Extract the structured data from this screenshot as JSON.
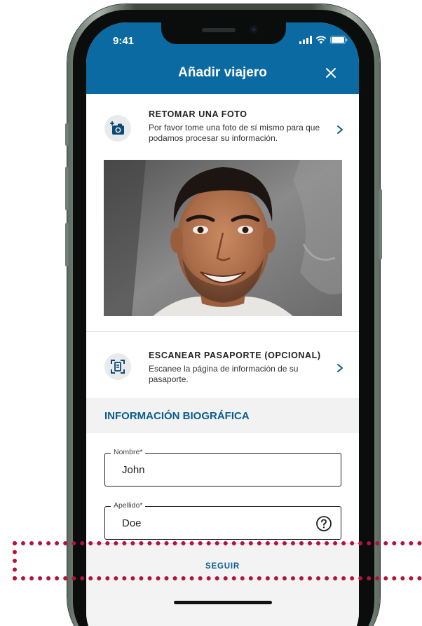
{
  "status_bar": {
    "time": "9:41",
    "icons": [
      "signal-icon",
      "wifi-icon",
      "battery-icon"
    ]
  },
  "header": {
    "title": "Añadir viajero",
    "close_icon": "close-icon"
  },
  "photo_row": {
    "title": "RETOMAR UNA FOTO",
    "description": "Por favor tome una foto de sí mismo para que podamos procesar su información.",
    "icon": "camera-retake-icon"
  },
  "passport_row": {
    "title": "ESCANEAR PASAPORTE (OPCIONAL)",
    "description": "Escanee la página de información de su pasaporte.",
    "icon": "passport-scan-icon"
  },
  "bio_section": {
    "title": "INFORMACIÓN BIOGRÁFICA"
  },
  "fields": {
    "first_name": {
      "label": "Nombre*",
      "value": "John"
    },
    "last_name": {
      "label": "Apellido*",
      "value": "Doe"
    }
  },
  "footer": {
    "continue_label": "SEGUIR"
  },
  "colors": {
    "brand_blue": "#0a6aa1",
    "section_title": "#0a5d8f",
    "highlight": "#b3123a"
  }
}
